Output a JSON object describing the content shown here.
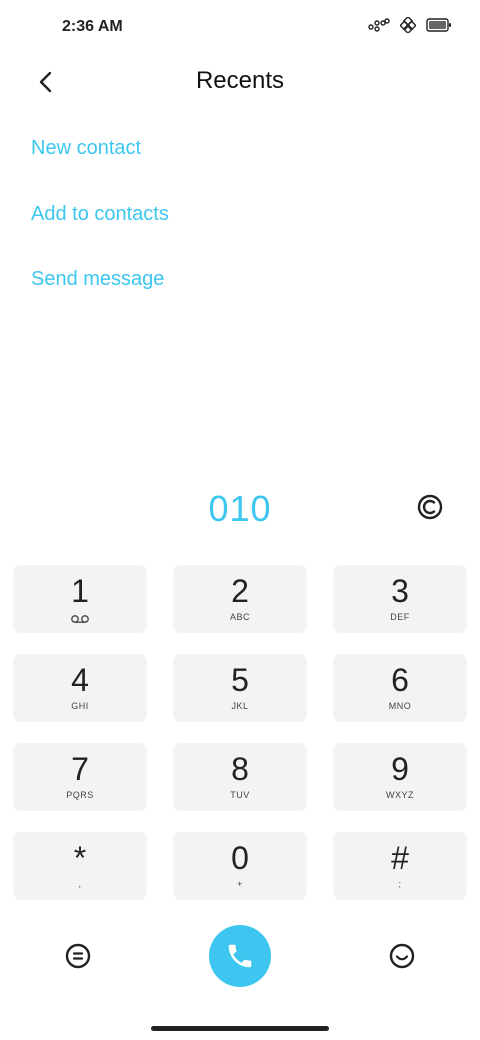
{
  "status_bar": {
    "time": "2:36 AM"
  },
  "header": {
    "title": "Recents"
  },
  "actions": [
    "New contact",
    "Add to contacts",
    "Send message"
  ],
  "dialed_number": "010",
  "keypad": [
    {
      "digit": "1",
      "letters": "",
      "voicemail": true
    },
    {
      "digit": "2",
      "letters": "ABC"
    },
    {
      "digit": "3",
      "letters": "DEF"
    },
    {
      "digit": "4",
      "letters": "GHI"
    },
    {
      "digit": "5",
      "letters": "JKL"
    },
    {
      "digit": "6",
      "letters": "MNO"
    },
    {
      "digit": "7",
      "letters": "PQRS"
    },
    {
      "digit": "8",
      "letters": "TUV"
    },
    {
      "digit": "9",
      "letters": "WXYZ"
    },
    {
      "digit": "*",
      "letters": ","
    },
    {
      "digit": "0",
      "letters": "+"
    },
    {
      "digit": "#",
      "letters": ";"
    }
  ],
  "colors": {
    "accent": "#3dc6ef",
    "key_bg": "#f3f3f3"
  },
  "icons": [
    "signal-icon",
    "link-icon",
    "battery-icon",
    "back-icon",
    "clear-icon",
    "voicemail-icon",
    "menu-icon",
    "call-icon",
    "emoji-icon"
  ]
}
